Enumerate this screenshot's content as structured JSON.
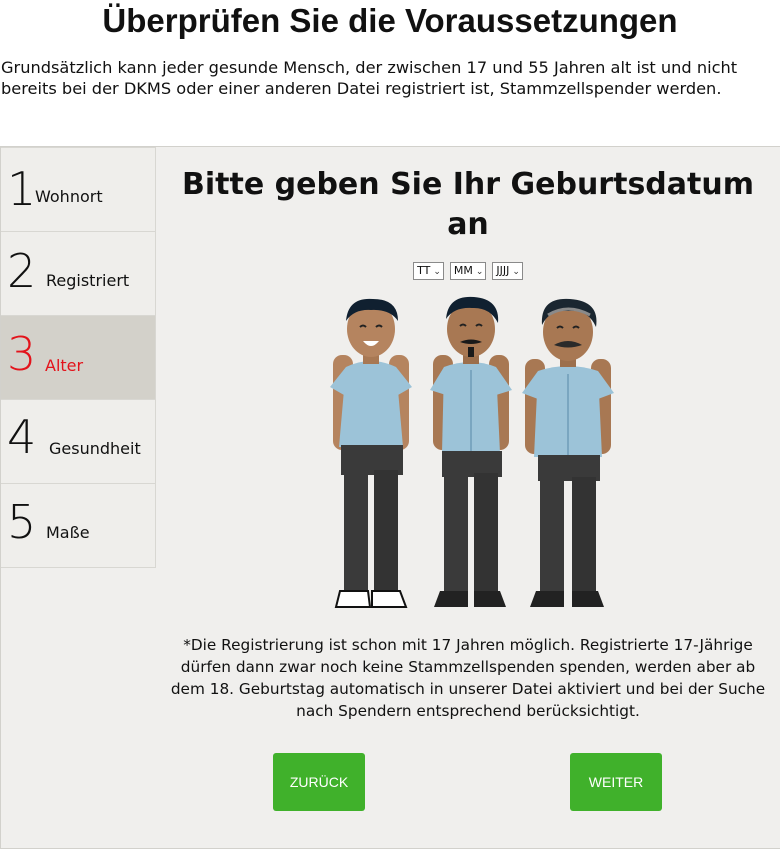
{
  "page": {
    "title": "Überprüfen Sie die Voraussetzungen",
    "intro": "Grundsätzlich kann jeder gesunde Mensch, der zwischen 17 und 55 Jahren alt ist und nicht bereits bei der DKMS oder einer anderen Datei registriert ist, Stammzellspender werden."
  },
  "steps": [
    {
      "number": "1",
      "label": "Wohnort",
      "active": false
    },
    {
      "number": "2",
      "label": "Registriert",
      "active": false
    },
    {
      "number": "3",
      "label": "Alter",
      "active": true
    },
    {
      "number": "4",
      "label": "Gesundheit",
      "active": false
    },
    {
      "number": "5",
      "label": "Maße",
      "active": false
    }
  ],
  "form": {
    "question": "Bitte geben Sie Ihr Geburtsdatum an",
    "day_value": "TT",
    "month_value": "MM",
    "year_value": "JJJJ"
  },
  "note": "*Die Registrierung ist schon mit 17 Jahren möglich. Registrierte 17-Jährige dürfen dann zwar noch keine Stammzellspenden spenden, werden aber ab dem 18. Geburtstag automatisch in unserer Datei aktiviert und bei der Suche nach Spendern entsprechend berücksichtigt.",
  "buttons": {
    "back": "ZURÜCK",
    "next": "WEITER"
  },
  "colors": {
    "accent_red": "#e3131b",
    "button_green": "#40b12b",
    "active_step_bg": "#d3d1ca",
    "panel_bg": "#f0efed"
  },
  "icons": {
    "select_arrow": "chevron-down-icon"
  }
}
